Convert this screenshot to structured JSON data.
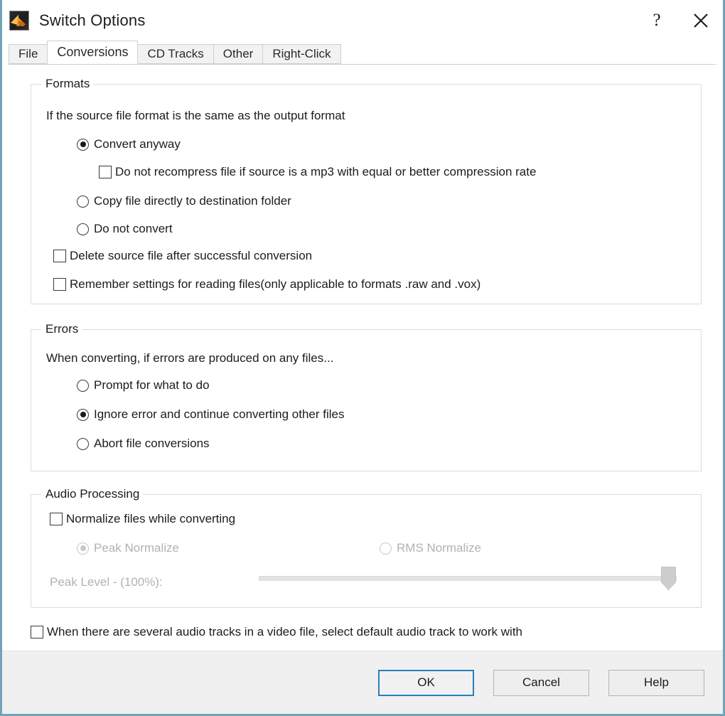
{
  "window": {
    "title": "Switch Options",
    "app_icon": "switch-app-icon",
    "controls": [
      {
        "name": "help-button",
        "glyph": "?"
      },
      {
        "name": "close-button",
        "glyph": "✕"
      }
    ]
  },
  "tabs": [
    {
      "id": "file",
      "label": "File",
      "active": false
    },
    {
      "id": "conversions",
      "label": "Conversions",
      "active": true
    },
    {
      "id": "cd-tracks",
      "label": "CD Tracks",
      "active": false
    },
    {
      "id": "other",
      "label": "Other",
      "active": false
    },
    {
      "id": "right-click",
      "label": "Right-Click",
      "active": false
    }
  ],
  "formats": {
    "legend": "Formats",
    "description": "If the source file format is the same as the output format",
    "radio_convert_anyway": {
      "label": "Convert anyway",
      "checked": true
    },
    "check_no_recompress": {
      "label": "Do not recompress file if source is a mp3 with equal or better compression rate",
      "checked": false
    },
    "radio_copy_directly": {
      "label": "Copy file directly to destination folder",
      "checked": false
    },
    "radio_do_not_convert": {
      "label": "Do not convert",
      "checked": false
    },
    "check_delete_source": {
      "label": "Delete source file after successful conversion",
      "checked": false
    },
    "check_remember_settings": {
      "label": "Remember settings for reading files(only applicable to formats .raw and .vox)",
      "checked": false
    }
  },
  "errors": {
    "legend": "Errors",
    "description": "When converting, if errors are produced on any files...",
    "radio_prompt": {
      "label": "Prompt for what to do",
      "checked": false
    },
    "radio_ignore": {
      "label": "Ignore error and continue converting other files",
      "checked": true
    },
    "radio_abort": {
      "label": "Abort file conversions",
      "checked": false
    }
  },
  "audio_processing": {
    "legend": "Audio Processing",
    "check_normalize": {
      "label": "Normalize files while converting",
      "checked": false
    },
    "radio_peak": {
      "label": "Peak Normalize",
      "checked": true,
      "disabled": true
    },
    "radio_rms": {
      "label": "RMS Normalize",
      "checked": false,
      "disabled": true
    },
    "peak_level_label": "Peak Level - (100%):",
    "peak_level_percent": 100
  },
  "video_tracks": {
    "check_default_audio_track": {
      "label": "When there are several audio tracks in a video file, select default audio track to work with",
      "checked": false
    }
  },
  "buttons": {
    "ok": "OK",
    "cancel": "Cancel",
    "help": "Help"
  },
  "colors": {
    "frame_border": "#6fa3b8",
    "default_button_focus": "#2b7fbb",
    "disabled_text": "#b2b2b2"
  }
}
